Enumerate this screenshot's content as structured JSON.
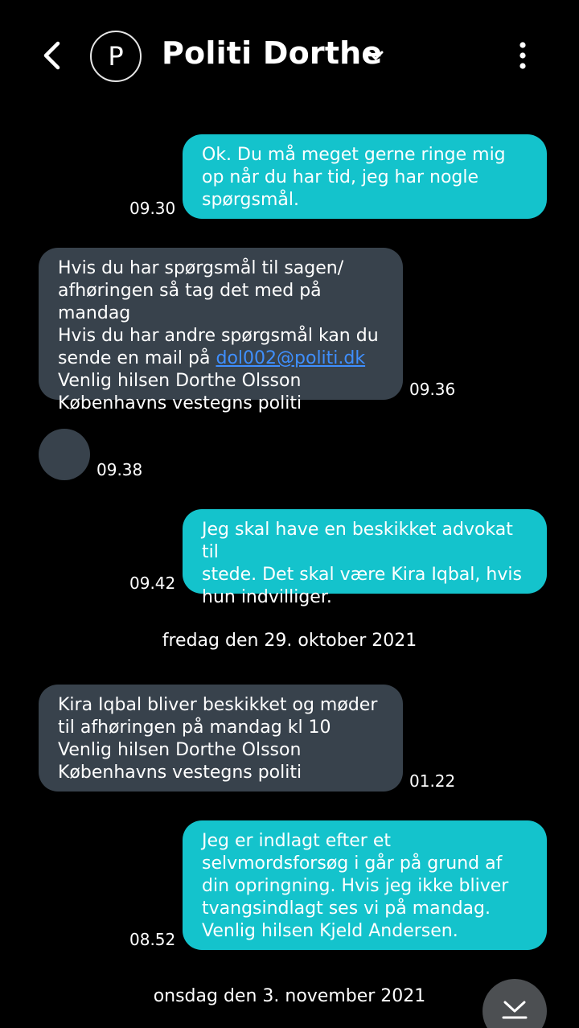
{
  "header": {
    "avatar_letter": "P",
    "contact_name": "Politi Dorthe",
    "icons": {
      "back": "back-arrow-icon",
      "expand": "chevron-down-icon",
      "menu": "more-vertical-icon"
    }
  },
  "colors": {
    "outgoing_bubble": "#14c3cc",
    "incoming_bubble": "#38424c",
    "link": "#3f8fff"
  },
  "messages": [
    {
      "direction": "out",
      "text": "Ok. Du må meget gerne ringe mig\nop når du har tid, jeg har nogle\nspørgsmål.",
      "time": "09.30"
    },
    {
      "direction": "in",
      "text_before_link": "Hvis du har spørgsmål til sagen/\nafhøringen så tag det med på mandag\nHvis du har andre spørgsmål kan du\nsende en mail på ",
      "link": "dol002@politi.dk",
      "text_after_link": "\nVenlig hilsen Dorthe Olsson\nKøbenhavns vestegns politi",
      "time": "09.36"
    },
    {
      "direction": "in",
      "type": "image",
      "time": "09.38"
    },
    {
      "direction": "out",
      "text": "Jeg skal have en beskikket advokat til\nstede. Det skal være Kira Iqbal, hvis\nhun indvilliger.",
      "time": "09.42"
    },
    {
      "direction": "in",
      "text": "Kira Iqbal bliver beskikket og møder\ntil afhøringen på mandag kl 10\nVenlig hilsen Dorthe Olsson\nKøbenhavns vestegns politi",
      "time": "01.22"
    },
    {
      "direction": "out",
      "text": "Jeg er indlagt efter et\nselvmordsforsøg i går på grund af\ndin opringning. Hvis jeg ikke bliver\ntvangsindlagt ses vi på mandag.\nVenlig hilsen Kjeld Andersen.",
      "time": "08.52"
    }
  ],
  "date_separators": [
    "fredag den 29. oktober 2021",
    "onsdag den 3. november 2021"
  ],
  "scroll_button_icon": "scroll-down-icon"
}
